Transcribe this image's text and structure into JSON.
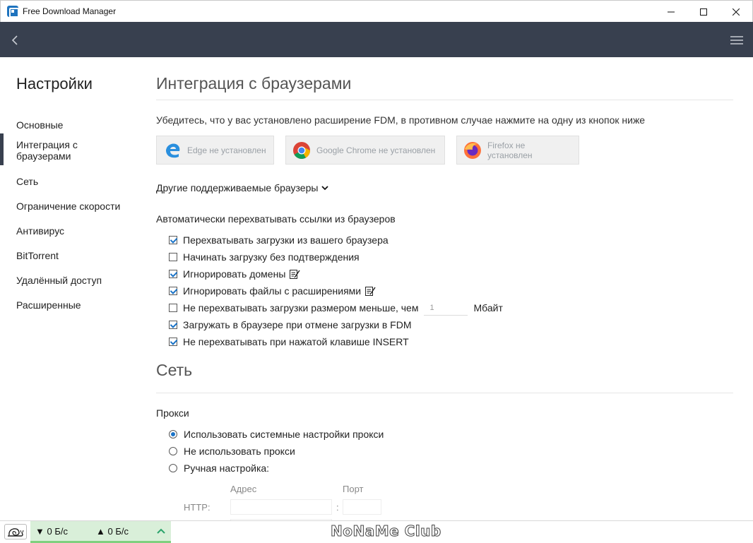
{
  "window": {
    "title": "Free Download Manager",
    "controls": [
      "minimize",
      "maximize",
      "close"
    ]
  },
  "header": {
    "back_icon": "chevron-left-icon",
    "menu_icon": "hamburger-menu-icon"
  },
  "sidebar": {
    "title": "Настройки",
    "items": [
      {
        "label": "Основные",
        "active": false
      },
      {
        "label": "Интеграция с браузерами",
        "active": true
      },
      {
        "label": "Сеть",
        "active": false
      },
      {
        "label": "Ограничение скорости",
        "active": false
      },
      {
        "label": "Антивирус",
        "active": false
      },
      {
        "label": "BitTorrent",
        "active": false
      },
      {
        "label": "Удалённый доступ",
        "active": false
      },
      {
        "label": "Расширенные",
        "active": false
      }
    ]
  },
  "browser_integration": {
    "heading": "Интеграция с браузерами",
    "note": "Убедитесь, что у вас установлено расширение FDM, в противном случае нажмите на одну из кнопок ниже",
    "browsers": [
      {
        "label": "Edge не установлен",
        "icon": "edge-icon"
      },
      {
        "label": "Google Chrome не установлен",
        "icon": "chrome-icon"
      },
      {
        "label": "Firefox не установлен",
        "icon": "firefox-icon"
      }
    ],
    "other_browsers": "Другие поддерживаемые браузеры",
    "auto_catch_label": "Автоматически перехватывать ссылки из браузеров",
    "options": [
      {
        "label": "Перехватывать загрузки из вашего браузера",
        "checked": true
      },
      {
        "label": "Начинать загрузку без подтверждения",
        "checked": false
      },
      {
        "label": "Игнорировать домены",
        "checked": true
      },
      {
        "label": "Игнорировать файлы с расширениями",
        "checked": true
      },
      {
        "label": "Не перехватывать загрузки размером меньше, чем",
        "checked": false
      },
      {
        "label": "Загружать в браузере при отмене загрузки в FDM",
        "checked": true
      },
      {
        "label": "Не перехватывать при нажатой клавише INSERT",
        "checked": true
      }
    ],
    "min_size_value": "1",
    "min_size_unit": "Мбайт"
  },
  "network": {
    "heading": "Сеть",
    "proxy_label": "Прокси",
    "proxy_options": [
      {
        "label": "Использовать системные настройки прокси",
        "selected": true
      },
      {
        "label": "Не использовать прокси",
        "selected": false
      },
      {
        "label": "Ручная настройка:",
        "selected": false
      }
    ],
    "address_label": "Адрес",
    "port_label": "Порт",
    "http_label": "HTTP:",
    "colon": ":"
  },
  "statusbar": {
    "download_speed": "▼ 0 Б/с",
    "upload_speed": "▲ 0 Б/с",
    "watermark": "NoNaMe Club",
    "accent_color": "#7ed07e"
  },
  "colors": {
    "header_bg": "#38404f",
    "check_accent": "#1a73c7"
  }
}
